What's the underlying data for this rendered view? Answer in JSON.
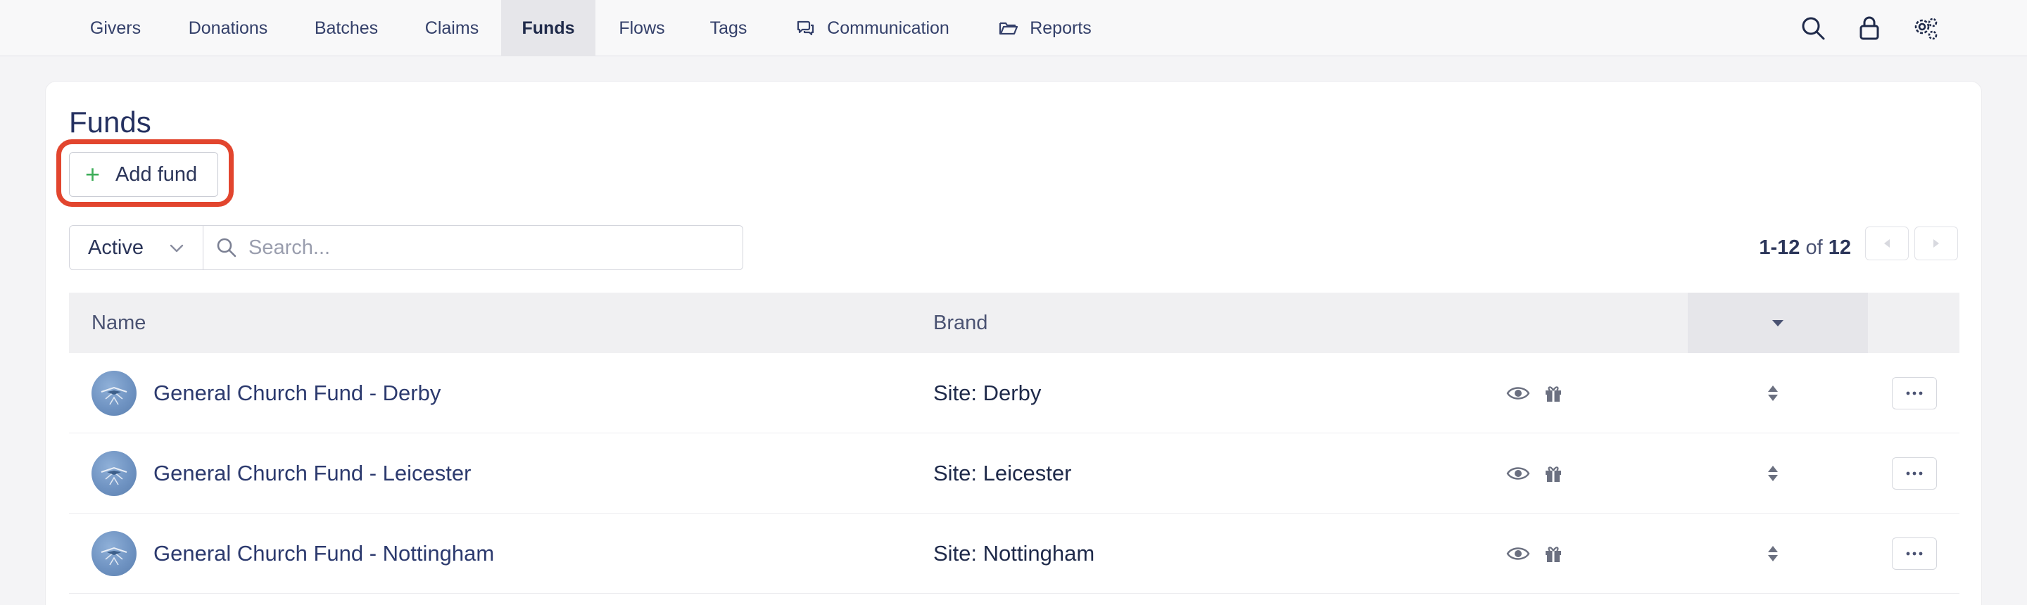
{
  "nav": {
    "items": [
      {
        "label": "Givers",
        "active": false
      },
      {
        "label": "Donations",
        "active": false
      },
      {
        "label": "Batches",
        "active": false
      },
      {
        "label": "Claims",
        "active": false
      },
      {
        "label": "Funds",
        "active": true
      },
      {
        "label": "Flows",
        "active": false
      },
      {
        "label": "Tags",
        "active": false
      },
      {
        "label": "Communication",
        "active": false,
        "icon": "chat-bubbles-icon"
      },
      {
        "label": "Reports",
        "active": false,
        "icon": "folder-open-icon"
      }
    ],
    "right_icons": [
      "search-icon",
      "lock-icon",
      "gears-icon"
    ]
  },
  "page": {
    "title": "Funds",
    "add_button_label": "Add fund",
    "highlight_color": "#e2452e"
  },
  "filters": {
    "status_value": "Active",
    "search_placeholder": "Search..."
  },
  "pagination": {
    "range": "1-12",
    "of_label": "of",
    "total": "12"
  },
  "table": {
    "columns": {
      "name": "Name",
      "brand": "Brand"
    },
    "rows": [
      {
        "name": "General Church Fund - Derby",
        "brand": "Site: Derby"
      },
      {
        "name": "General Church Fund - Leicester",
        "brand": "Site: Leicester"
      },
      {
        "name": "General Church Fund - Nottingham",
        "brand": "Site: Nottingham"
      }
    ]
  },
  "colors": {
    "accent_green": "#3fae5a",
    "text_navy": "#243060",
    "active_tab_bg": "#e6e6ea"
  }
}
